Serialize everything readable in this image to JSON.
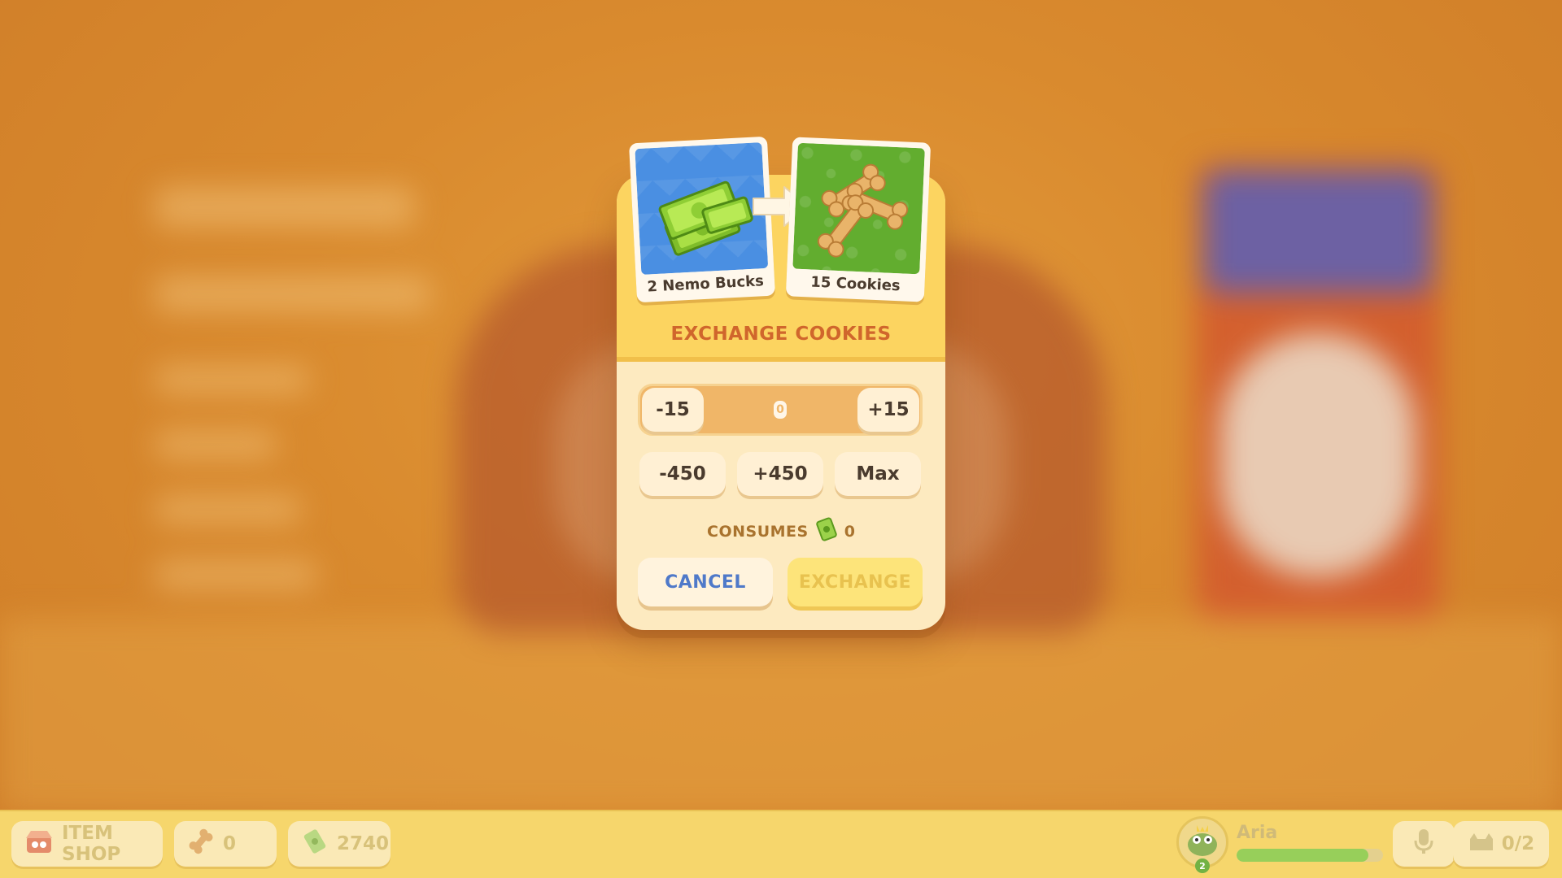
{
  "exchange": {
    "title": "EXCHANGE COOKIES",
    "from_card": {
      "caption": "2 Nemo Bucks",
      "icon": "cash-stack-icon"
    },
    "to_card": {
      "caption": "15 Cookies",
      "icon": "dog-biscuit-icon"
    },
    "arrow_icon": "arrow-right-icon",
    "stepper": {
      "minus_small": "-15",
      "value": "0",
      "plus_small": "+15"
    },
    "quick": {
      "minus_large": "-450",
      "plus_large": "+450",
      "max": "Max"
    },
    "consumes": {
      "label": "CONSUMES",
      "icon": "nemo-buck-icon",
      "amount": "0"
    },
    "cancel_label": "CANCEL",
    "exchange_label": "EXCHANGE"
  },
  "bottom_bar": {
    "item_shop": {
      "label": "ITEM SHOP",
      "icon": "shop-icon"
    },
    "cookies": {
      "icon": "dog-biscuit-icon",
      "value": "0"
    },
    "bucks": {
      "icon": "nemo-buck-icon",
      "value": "2740"
    },
    "player": {
      "name": "Aria",
      "level": "2",
      "progress": 0.9,
      "avatar_icon": "dragon-avatar-icon"
    },
    "mic_icon": "microphone-icon",
    "party": {
      "icon": "pets-icon",
      "value": "0/2"
    }
  },
  "colors": {
    "modal_header": "#fcd460",
    "modal_body": "#fdeac0",
    "title": "#d0662c",
    "cancel_text": "#4f79c9",
    "exchange_disabled": "#fde47a",
    "progress_fill": "#97cf5a"
  }
}
